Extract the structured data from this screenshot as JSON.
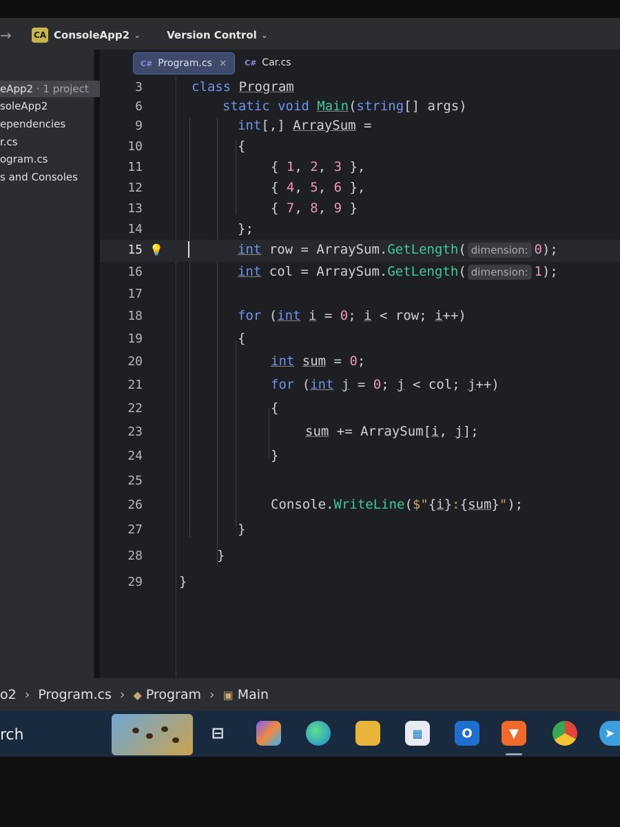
{
  "toolbar": {
    "back_icon": "arrow-right-icon",
    "project_badge": "CA",
    "project_name": "ConsoleApp2",
    "version_control": "Version Control"
  },
  "sidebar": {
    "items": [
      {
        "label": "eApp2",
        "suffix": " · 1 project"
      },
      {
        "label": "soleApp2"
      },
      {
        "label": "ependencies"
      },
      {
        "label": "r.cs"
      },
      {
        "label": "ogram.cs"
      },
      {
        "label": "s and Consoles"
      }
    ]
  },
  "tabs": [
    {
      "icon": "C#",
      "label": "Program.cs",
      "active": true,
      "close": "×"
    },
    {
      "icon": "C#",
      "label": "Car.cs",
      "active": false
    }
  ],
  "editor": {
    "line_numbers": [
      "3",
      "6",
      "9",
      "10",
      "11",
      "12",
      "13",
      "14",
      "15",
      "16",
      "17",
      "18",
      "19",
      "20",
      "21",
      "22",
      "23",
      "24",
      "25",
      "26",
      "27",
      "28",
      "29"
    ],
    "current_line": "15",
    "hints": {
      "dimension": "dimension:"
    }
  },
  "breadcrumb": {
    "items": [
      "o2",
      "Program.cs",
      "Program",
      "Main"
    ]
  },
  "taskbar": {
    "search_label": "rch",
    "apps": [
      "task-view",
      "copilot",
      "edge",
      "file-explorer",
      "microsoft-store",
      "outlook",
      "brave",
      "chrome",
      "telegram"
    ]
  },
  "colors": {
    "keyword": "#6c95eb",
    "method": "#39cc9b",
    "number": "#ed94c0",
    "string": "#c9a26d",
    "editor_bg": "#1e1f22",
    "tab_active": "#3d4a6b"
  }
}
